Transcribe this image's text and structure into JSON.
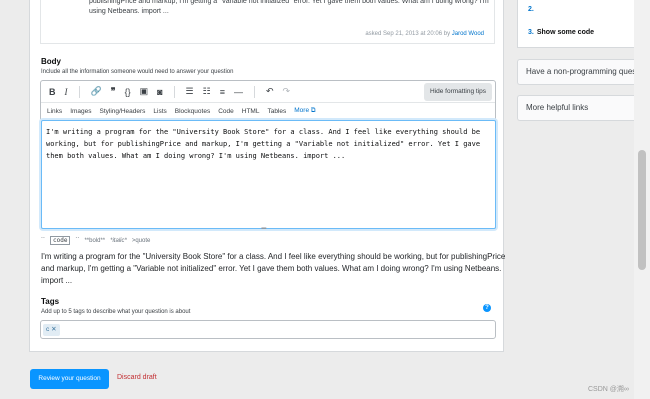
{
  "previous_question": {
    "text": "publishingPrice and markup, I'm getting a \"Variable not initialized\" error. Yet I gave them both values. What am I doing wrong? I'm using Netbeans. import ...",
    "asked": "asked Sep 21, 2013 at 20:06 by",
    "user": "Jarod Wood"
  },
  "body": {
    "label": "Body",
    "description": "Include all the information someone would need to answer your question",
    "tips_button": "Hide formatting tips",
    "tabs": [
      "Links",
      "Images",
      "Styling/Headers",
      "Lists",
      "Blockquotes",
      "Code",
      "HTML",
      "Tables",
      "More"
    ],
    "text": "I'm writing a program for the \"University Book Store\" for a class. And I feel like everything should be working, but for publishingPrice and markup, I'm getting a \"Variable not initialized\" error. Yet I gave them both values. What am I doing wrong? I'm using Netbeans. import ..."
  },
  "hints": {
    "code": "code",
    "bold": "**bold**",
    "italic": "*italic*",
    "quote": ">quote"
  },
  "preview": "I'm writing a program for the \"University Book Store\" for a class. And I feel like everything should be working, but for publishingPrice and markup, I'm getting a \"Variable not initialized\" error. Yet I gave them both values. What am I doing wrong? I'm using Netbeans. import ...",
  "tags": {
    "label": "Tags",
    "description": "Add up to 5 tags to describe what your question is about",
    "items": [
      "c"
    ]
  },
  "actions": {
    "review": "Review your question",
    "discard": "Discard draft"
  },
  "sidebar": {
    "step_prev": "2.",
    "step_num": "3.",
    "step_label": "Show some code",
    "card2": "Have a non-programming question?",
    "card3": "More helpful links"
  },
  "watermark": "CSDN @溯∞"
}
